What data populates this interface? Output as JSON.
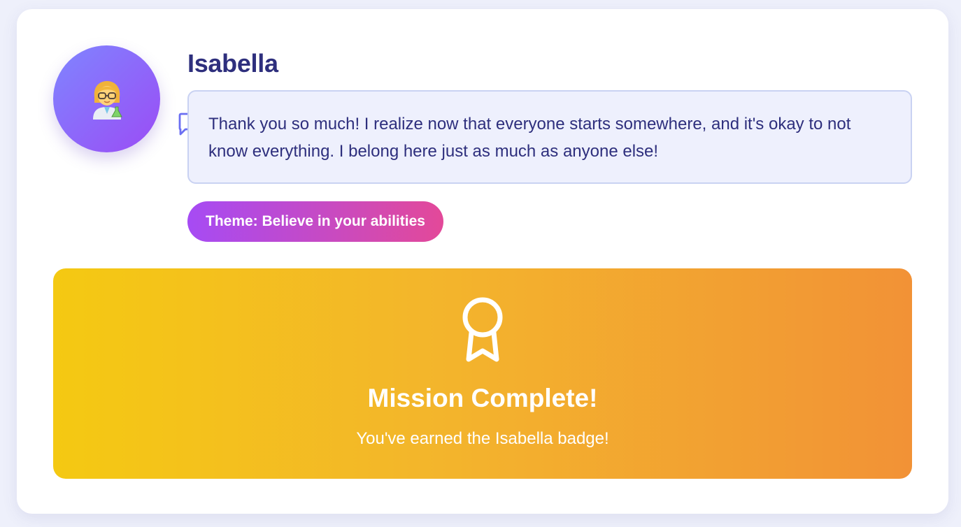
{
  "character": {
    "name": "Isabella",
    "avatar_icon": "scientist-woman-icon",
    "avatar_gradient": [
      "#7f85ff",
      "#9b4cf5"
    ],
    "message": "Thank you so much! I realize now that everyone starts somewhere, and it's okay to not know everything. I belong here just as much as anyone else!",
    "message_icon": "chat-bubble-icon"
  },
  "theme": {
    "label": "Theme: Believe in your abilities",
    "gradient": [
      "#a64bf4",
      "#e34999"
    ]
  },
  "mission": {
    "icon": "award-ribbon-icon",
    "title": "Mission Complete!",
    "subtitle": "You've earned the Isabella badge!",
    "gradient": [
      "#f4c912",
      "#f29236"
    ]
  },
  "colors": {
    "primary_text": "#2e2f7d",
    "bubble_bg": "#eef0fd",
    "bubble_border": "#c9d2f2",
    "icon_accent": "#6b6ff2"
  }
}
